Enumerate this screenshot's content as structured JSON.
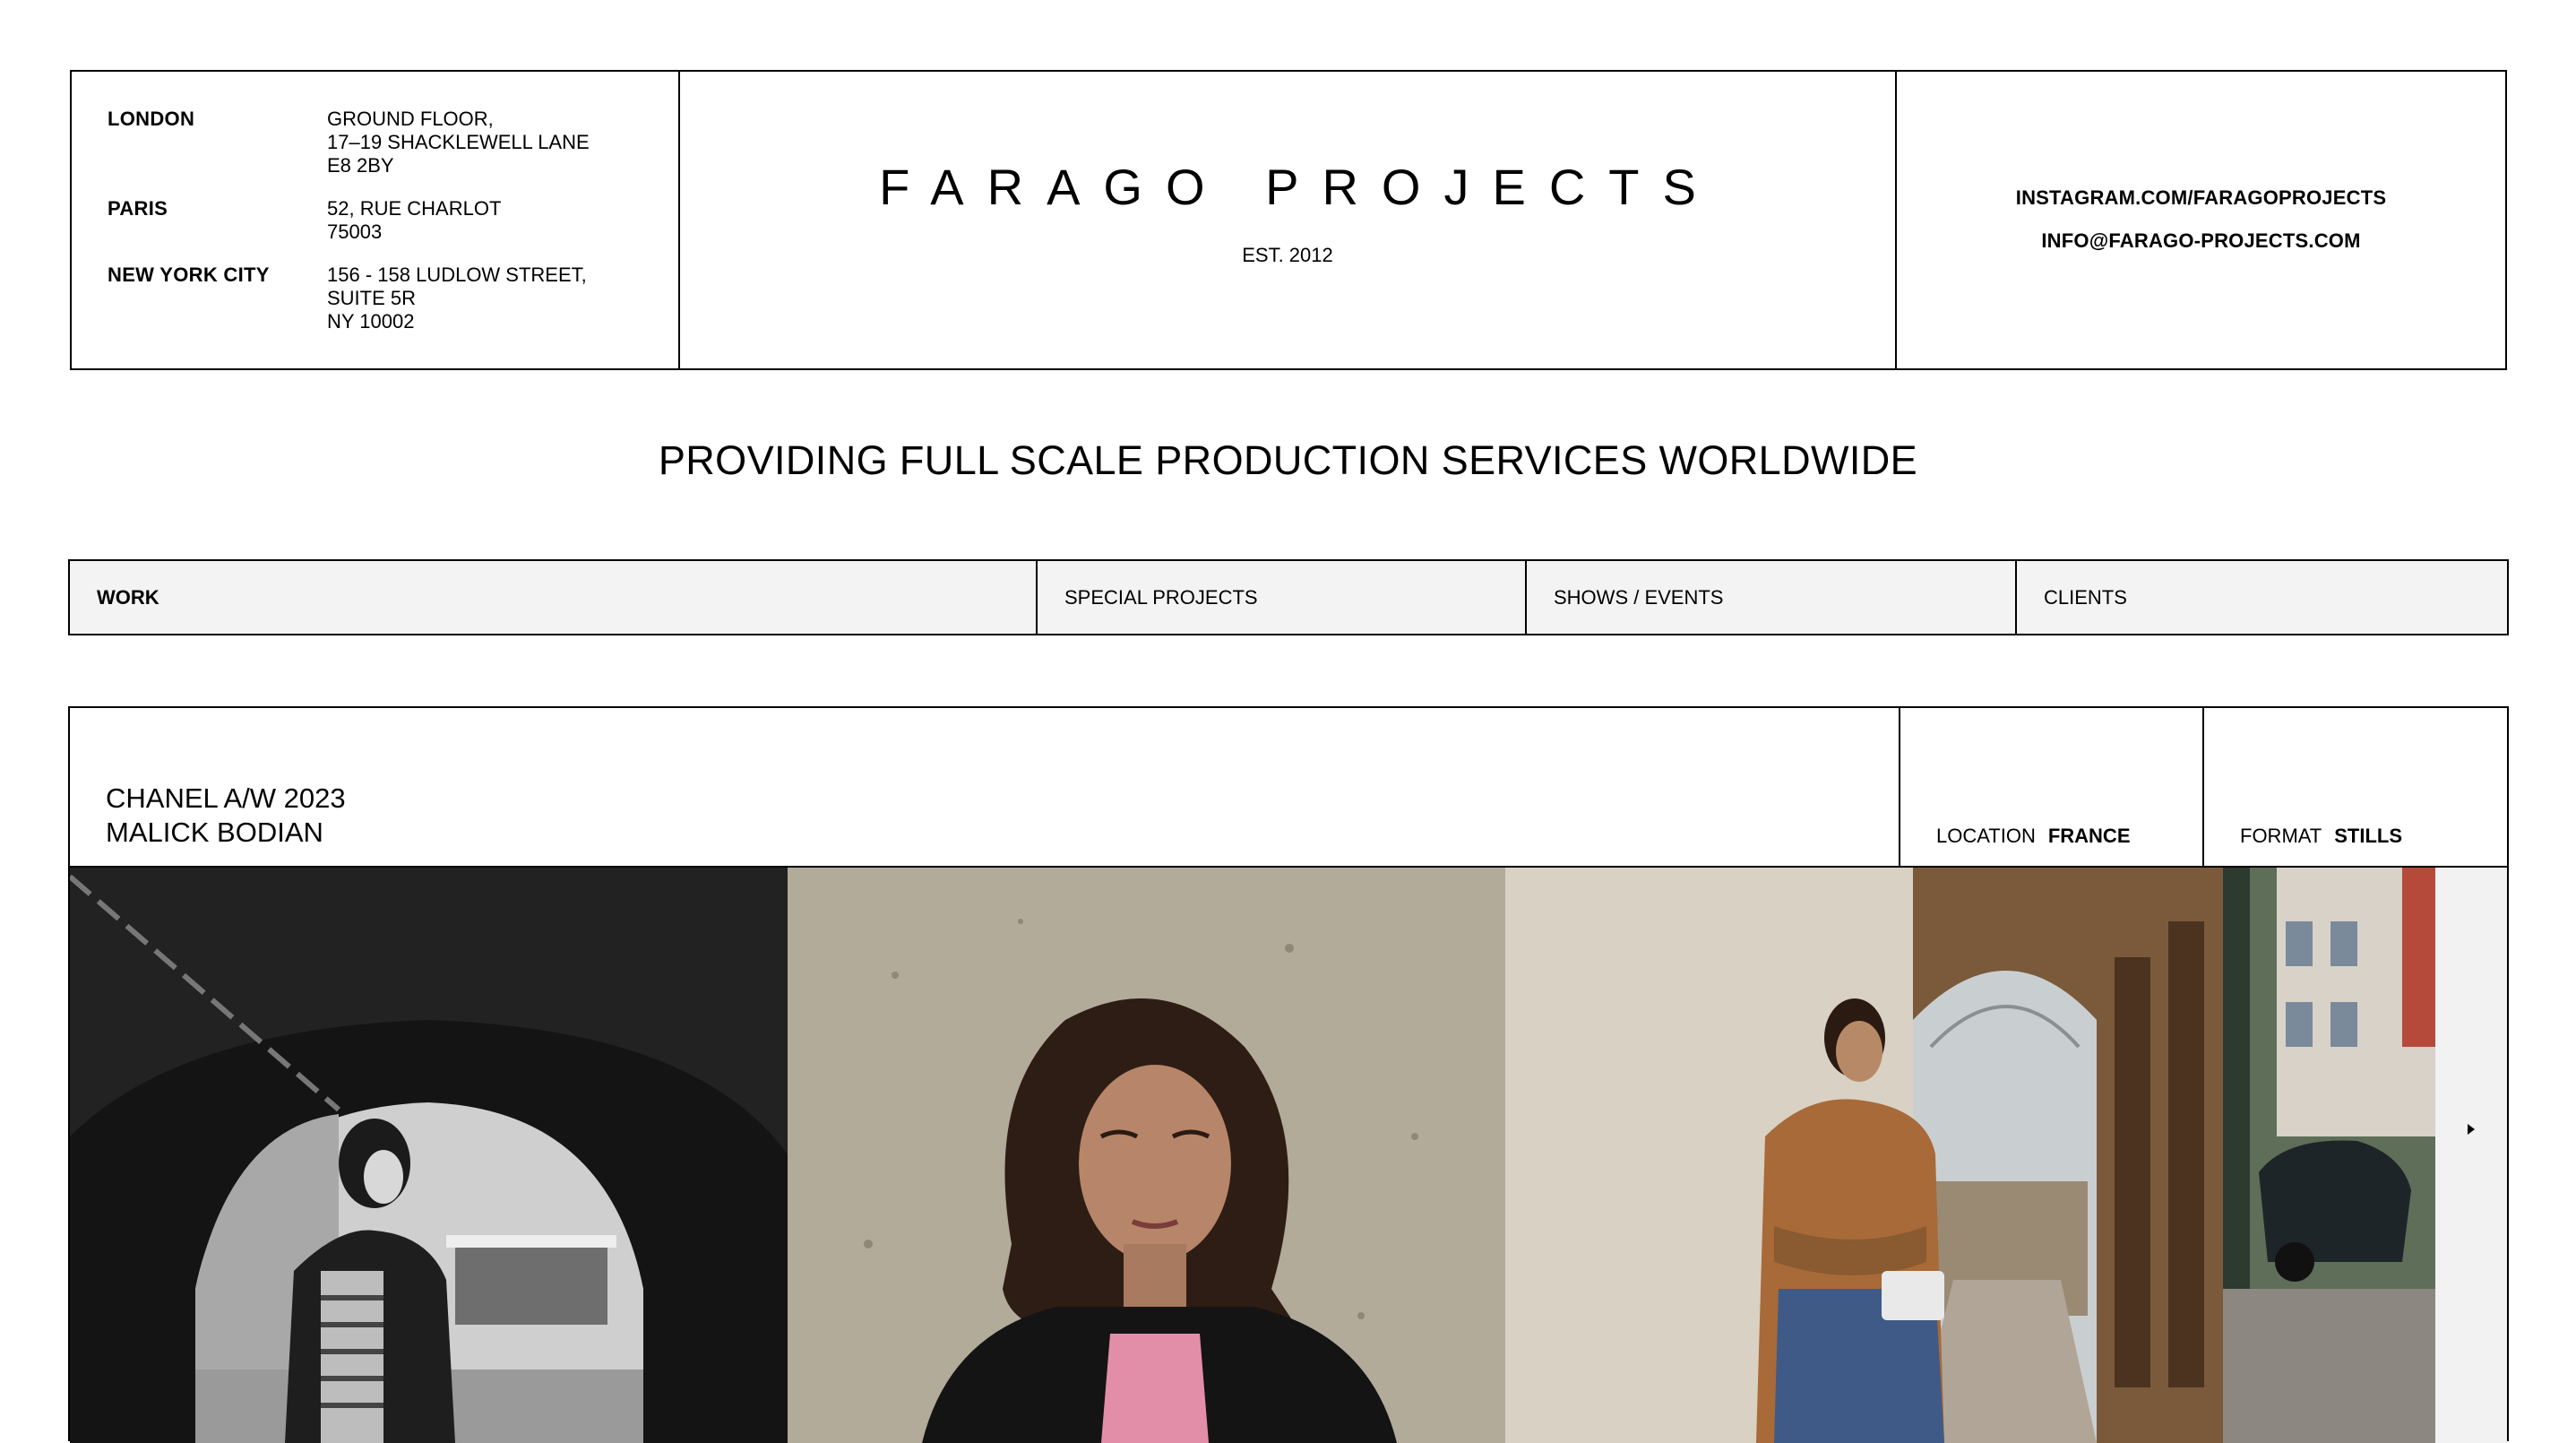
{
  "header": {
    "addresses": [
      {
        "city": "LONDON",
        "lines": "GROUND FLOOR,\n17–19 SHACKLEWELL LANE\nE8 2BY"
      },
      {
        "city": "PARIS",
        "lines": "52, RUE CHARLOT\n75003"
      },
      {
        "city": "NEW YORK CITY",
        "lines": "156 - 158 LUDLOW STREET,\nSUITE 5R\nNY 10002"
      }
    ],
    "brand": "FARAGO PROJECTS",
    "est": "EST. 2012",
    "instagram": "INSTAGRAM.COM/FARAGOPROJECTS",
    "email": "INFO@FARAGO-PROJECTS.COM"
  },
  "tagline": "PROVIDING FULL SCALE PRODUCTION SERVICES WORLDWIDE",
  "nav": {
    "items": [
      {
        "label": "WORK"
      },
      {
        "label": "SPECIAL PROJECTS"
      },
      {
        "label": "SHOWS / EVENTS"
      },
      {
        "label": "CLIENTS"
      }
    ]
  },
  "project": {
    "title_line1": "CHANEL A/W 2023",
    "title_line2": "MALICK BODIAN",
    "location_label": "LOCATION",
    "location_value": "FRANCE",
    "format_label": "FORMAT",
    "format_value": "STILLS",
    "next_icon": "chevron-right-icon"
  }
}
